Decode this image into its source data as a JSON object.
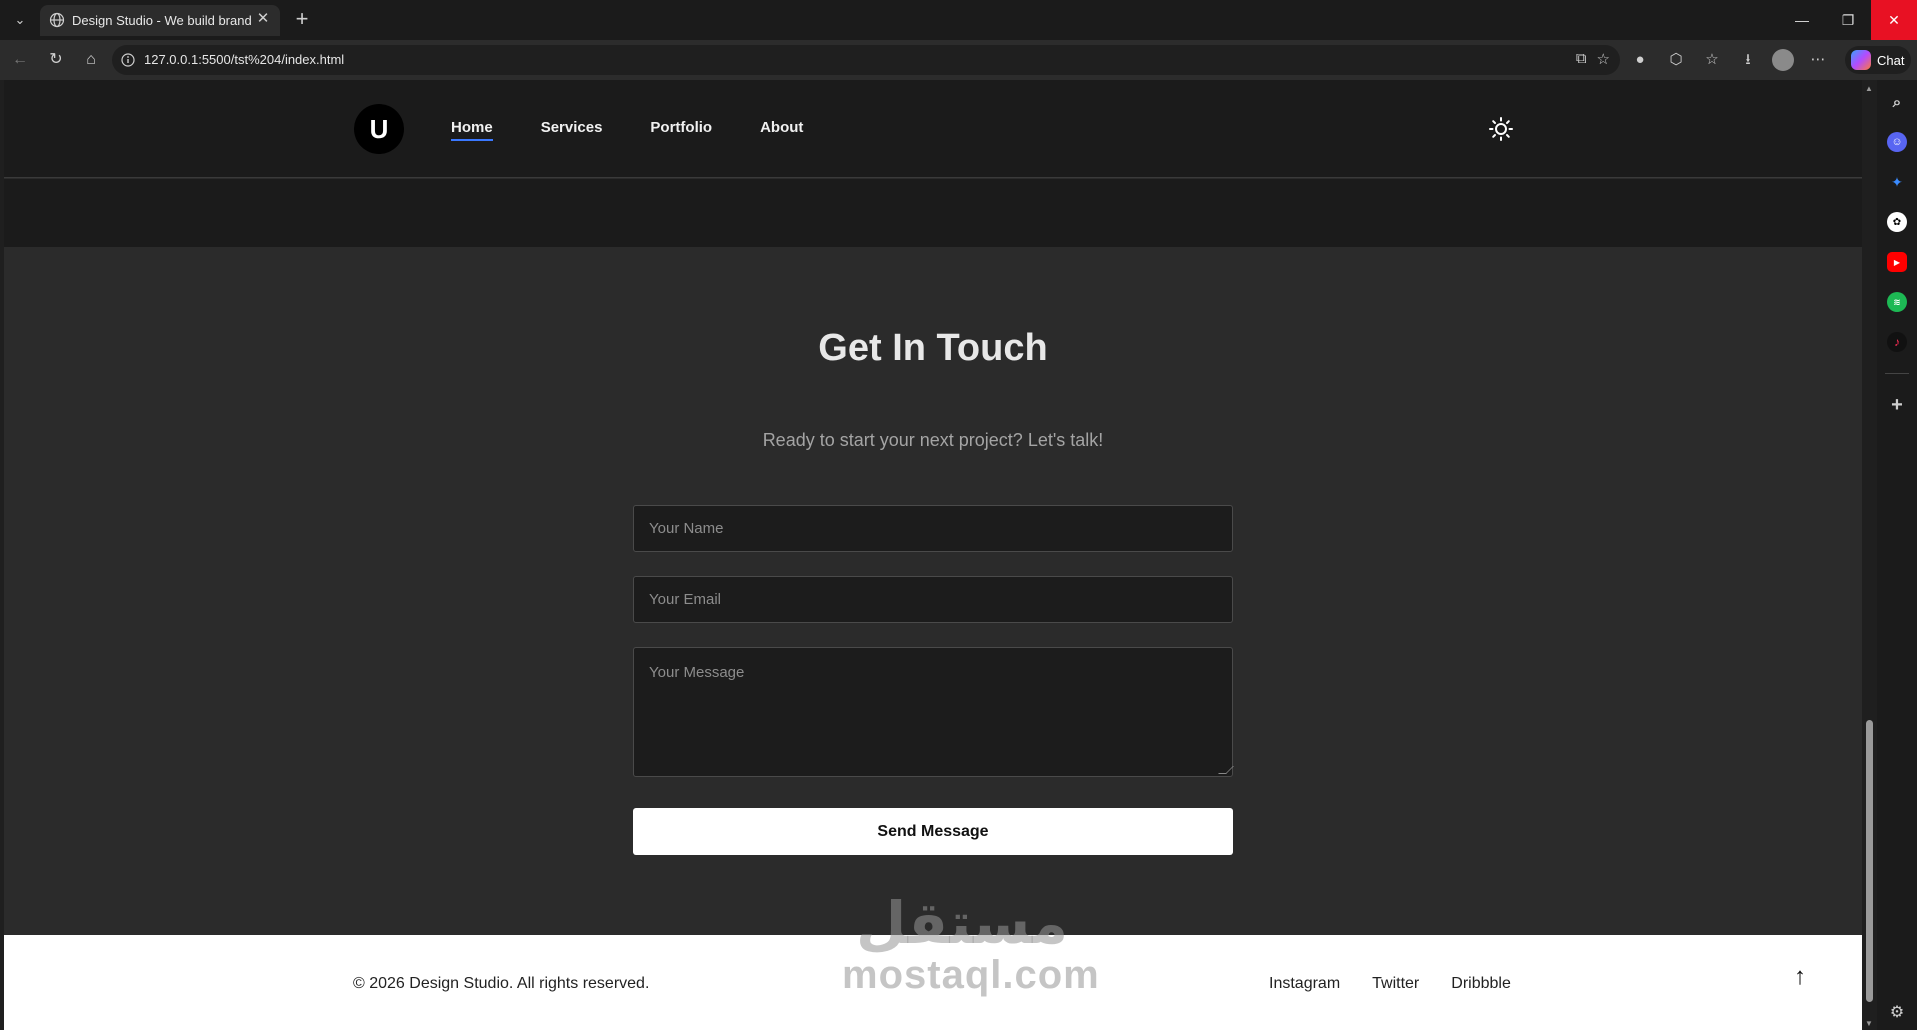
{
  "browser": {
    "tab_title": "Design Studio - We build brands fo",
    "url": "127.0.0.1:5500/tst%204/index.html",
    "chat_label": "Chat"
  },
  "site": {
    "logo_letter": "U",
    "nav": [
      {
        "label": "Home",
        "active": true
      },
      {
        "label": "Services"
      },
      {
        "label": "Portfolio"
      },
      {
        "label": "About"
      }
    ]
  },
  "contact": {
    "title": "Get In Touch",
    "subtitle": "Ready to start your next project? Let's talk!",
    "name_placeholder": "Your Name",
    "email_placeholder": "Your Email",
    "message_placeholder": "Your Message",
    "send_label": "Send Message"
  },
  "footer": {
    "copyright": "© 2026 Design Studio. All rights reserved.",
    "links": [
      "Instagram",
      "Twitter",
      "Dribbble"
    ],
    "back_to_top": "↑"
  },
  "watermark": {
    "arabic": "مستقل",
    "latin": "mostaql.com"
  },
  "colors": {
    "accent": "#3a78ff",
    "page_bg": "#2b2b2b",
    "header_bg": "#1b1b1b"
  }
}
